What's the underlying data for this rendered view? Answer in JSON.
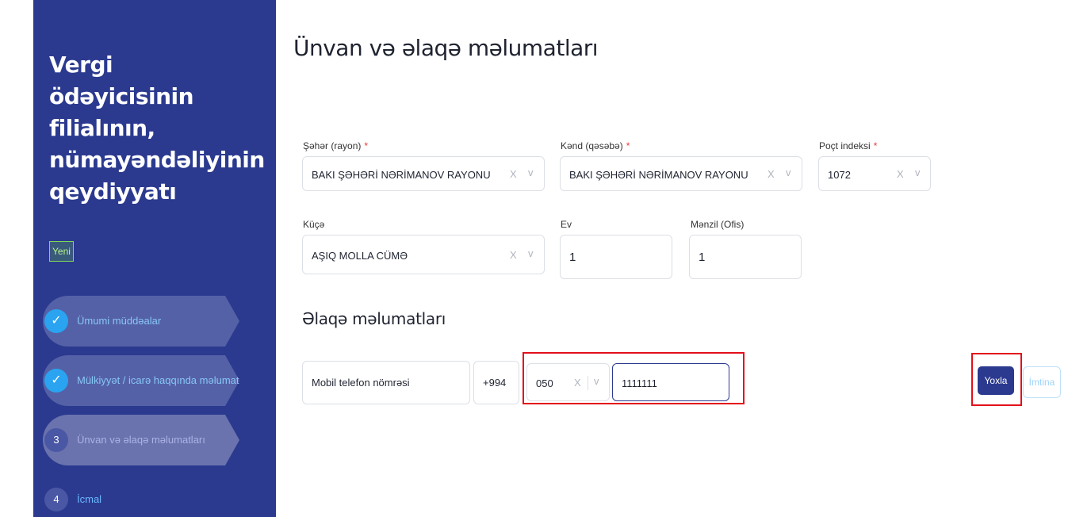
{
  "sidebar": {
    "title": "Vergi ödəyicisinin filialının, nümayəndəliyinin qeydiyyatı",
    "badge": "Yeni",
    "steps": [
      {
        "marker": "✓",
        "label": "Ümumi müddəalar",
        "state": "done"
      },
      {
        "marker": "✓",
        "label": "Mülkiyyət / icarə haqqında məlumat",
        "state": "done"
      },
      {
        "marker": "3",
        "label": "Ünvan və əlaqə məlumatları",
        "state": "active"
      },
      {
        "marker": "4",
        "label": "İcmal",
        "state": "pending"
      }
    ]
  },
  "main": {
    "title": "Ünvan və əlaqə məlumatları",
    "address": {
      "city_label": "Şəhər (rayon)",
      "city_value": "BAKI ŞƏHƏRİ NƏRİMANOV RAYONU",
      "village_label": "Kənd (qəsəbə)",
      "village_value": "BAKI ŞƏHƏRİ NƏRİMANOV RAYONU",
      "postal_label": "Poçt indeksi",
      "postal_value": "1072",
      "street_label": "Küçə",
      "street_value": "AŞIQ MOLLA CÜMƏ",
      "house_label": "Ev",
      "house_value": "1",
      "apt_label": "Mənzil (Ofis)",
      "apt_value": "1",
      "required_mark": "*",
      "clear_glyph": "X",
      "chevron_glyph": "v"
    },
    "contact": {
      "title": "Əlaqə məlumatları",
      "type_value": "Mobil telefon nömrəsi",
      "country_code": "+994",
      "operator_code": "050",
      "number_value": "1111111"
    },
    "buttons": {
      "check": "Yoxla",
      "cancel": "İmtina"
    }
  },
  "colors": {
    "sidebar_bg": "#2b3a8f",
    "step_done_circle": "#2aa3f0",
    "primary_button": "#2b3a8f",
    "highlight_border": "#e3101a",
    "required": "#e53935"
  }
}
